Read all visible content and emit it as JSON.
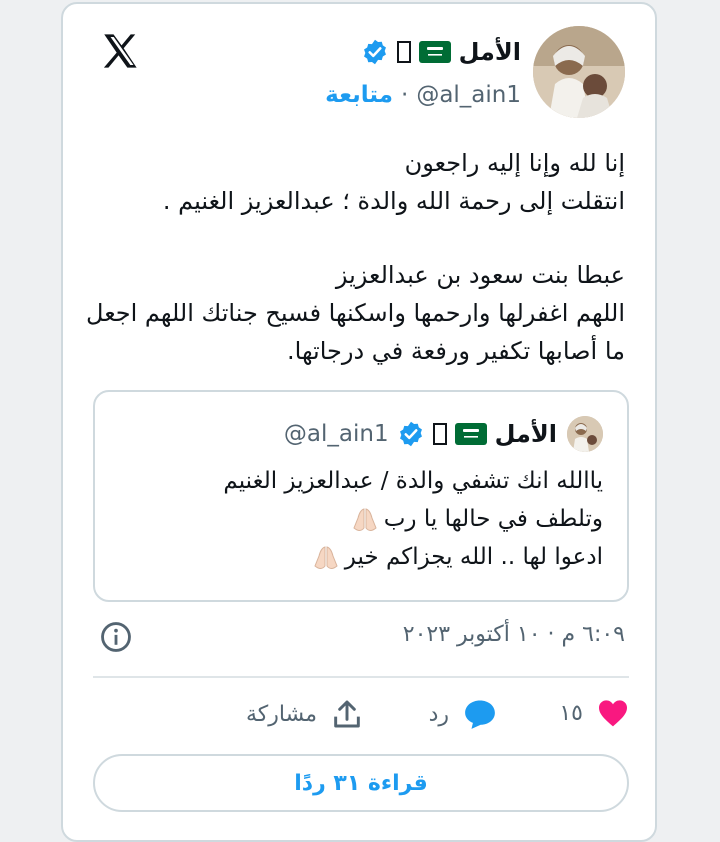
{
  "tweet": {
    "author_name": "الأمل",
    "handle": "@al_ain1",
    "separator": "·",
    "follow_label": "متابعة",
    "text_lines": [
      "إنا لله وإنا إليه راجعون",
      "انتقلت إلى رحمة الله والدة ؛ عبدالعزيز الغنيم .",
      "",
      "عبطا بنت سعود بن عبدالعزيز",
      "اللهم اغفرلها وارحمها واسكنها فسيح جناتك اللهم اجعل",
      "ما أصابها تكفير ورفعة في درجاتها."
    ],
    "timestamp": "٦:٠٩ م · ١٠ أكتوبر ٢٠٢٣"
  },
  "quote": {
    "author_name": "الأمل",
    "handle": "@al_ain1",
    "text_lines": [
      "ياالله انك تشفي والدة / عبدالعزيز الغنيم",
      "وتلطف في حالها يا رب",
      "ادعوا لها .. الله يجزاكم خير"
    ]
  },
  "actions": {
    "like_count": "١٥",
    "reply_label": "رد",
    "share_label": "مشاركة"
  },
  "read_replies_label": "قراءة ٣١ ردًا",
  "icons": {
    "logo": "x-logo-icon",
    "verified": "verified-badge-icon",
    "flag": "saudi-flag-icon",
    "info": "info-icon",
    "like": "heart-icon",
    "reply": "reply-bubble-icon",
    "share": "share-upload-icon",
    "prayer": "praying-hands-icon"
  },
  "colors": {
    "accent": "#1d9bf0",
    "like": "#f91880",
    "secondary_text": "#536471",
    "border": "#cfd9de"
  }
}
